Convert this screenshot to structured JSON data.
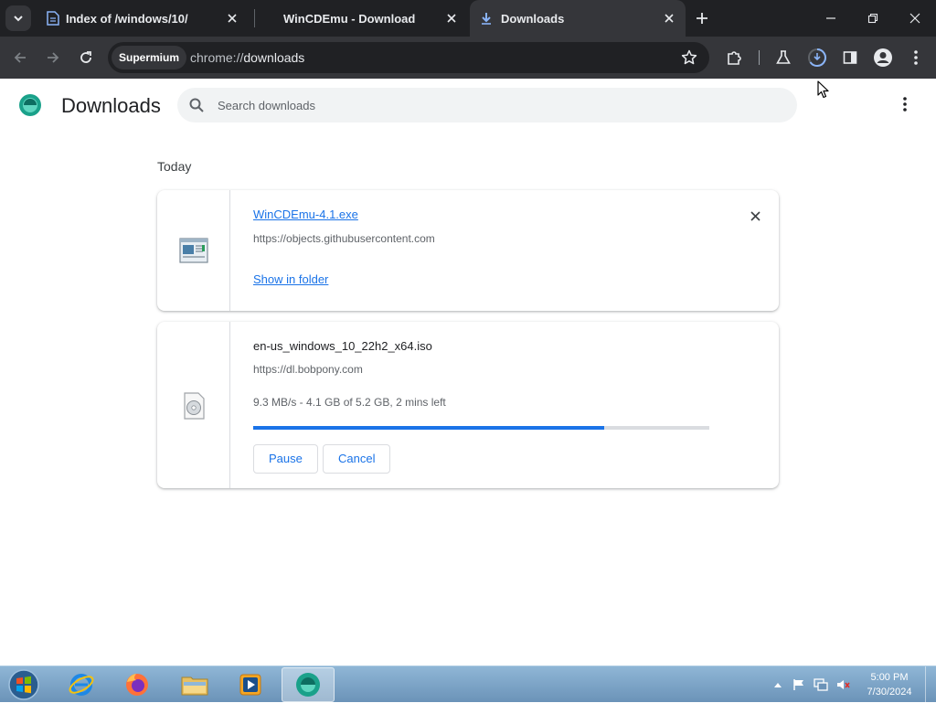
{
  "tabs": [
    {
      "title": "Index of /windows/10/",
      "icon": "page-icon"
    },
    {
      "title": "WinCDEmu - Download",
      "icon": "none"
    },
    {
      "title": "Downloads",
      "icon": "download-icon",
      "active": true
    }
  ],
  "toolbar": {
    "chip_label": "Supermium",
    "url_scheme": "chrome://",
    "url_path": "downloads"
  },
  "page": {
    "title": "Downloads",
    "search_placeholder": "Search downloads",
    "section_label": "Today"
  },
  "downloads": [
    {
      "file_name": "WinCDEmu-4.1.exe",
      "source_url": "https://objects.githubusercontent.com",
      "action_link": "Show in folder",
      "icon": "installer-icon"
    },
    {
      "file_name": "en-us_windows_10_22h2_x64.iso",
      "source_url": "https://dl.bobpony.com",
      "status": "9.3 MB/s - 4.1 GB of 5.2 GB, 2 mins left",
      "progress": 0.77,
      "pause_label": "Pause",
      "cancel_label": "Cancel",
      "icon": "disc-image-icon"
    }
  ],
  "taskbar": {
    "apps": [
      "internet-explorer-icon",
      "firefox-icon",
      "file-explorer-icon",
      "media-player-icon",
      "supermium-icon"
    ],
    "time": "5:00 PM",
    "date": "7/30/2024"
  },
  "colors": {
    "accent": "#1a73e8",
    "tabstrip": "#202124",
    "toolbar": "#35363a"
  }
}
